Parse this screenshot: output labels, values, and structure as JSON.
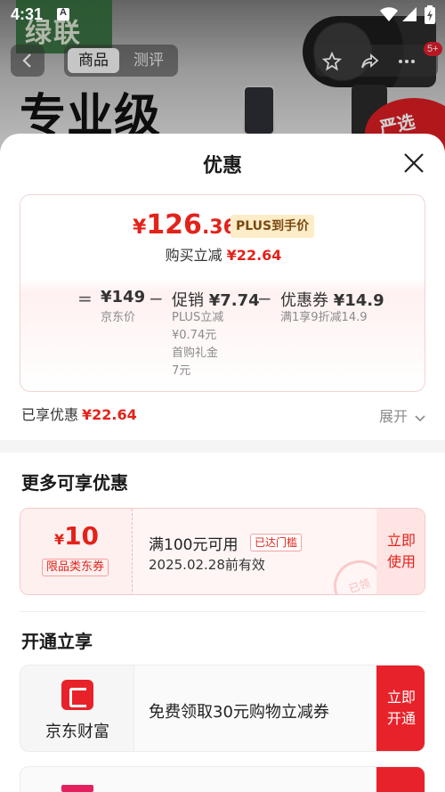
{
  "status_bar": {
    "time": "4:31"
  },
  "background": {
    "logo_text": "绿联",
    "headline": "专业级",
    "badge_text": "严选",
    "tabs": [
      "商品",
      "测评"
    ],
    "cart_badge": "5+"
  },
  "sheet": {
    "title": "优惠",
    "price_card": {
      "currency": "¥",
      "price_int": "126",
      "price_dec": ".36",
      "plus_tag": "PLUS到手价",
      "buy_reduce_label": "购买立减",
      "buy_reduce_value": "¥22.64",
      "breakdown": {
        "eq": "=",
        "jd_price": "¥149",
        "jd_price_label": "京东价",
        "minus1": "−",
        "promo_label": "促销",
        "promo_value": "¥7.74",
        "promo_sub1": "PLUS立减",
        "promo_sub2": "¥0.74元",
        "promo_sub3": "首购礼金",
        "promo_sub4": "7元",
        "minus2": "−",
        "coupon_label": "优惠券",
        "coupon_value": "¥14.9",
        "coupon_sub": "满1享9折减14.9"
      }
    },
    "enjoyed_label": "已享优惠",
    "enjoyed_value": "¥22.64",
    "expand_label": "展开",
    "more_section_title": "更多可享优惠",
    "coupon": {
      "currency": "¥",
      "amount": "10",
      "type": "限品类东券",
      "condition": "满100元可用",
      "tag": "已达门槛",
      "valid": "2025.02.28前有效",
      "use_line1": "立即",
      "use_line2": "使用",
      "stamp": "已领"
    },
    "open_section_title": "开通立享",
    "open_card": {
      "brand": "京东财富",
      "text": "免费领取30元购物立减券",
      "btn_line1": "立即",
      "btn_line2": "开通"
    }
  },
  "colors": {
    "accent_red": "#e2231a",
    "plus_tag_bg": "#fdecc8",
    "button_red": "#e8222a"
  },
  "icons": [
    "back-icon",
    "star-icon",
    "share-icon",
    "more-icon",
    "close-icon",
    "chevron-down-icon",
    "wifi-icon",
    "signal-icon",
    "battery-icon"
  ]
}
